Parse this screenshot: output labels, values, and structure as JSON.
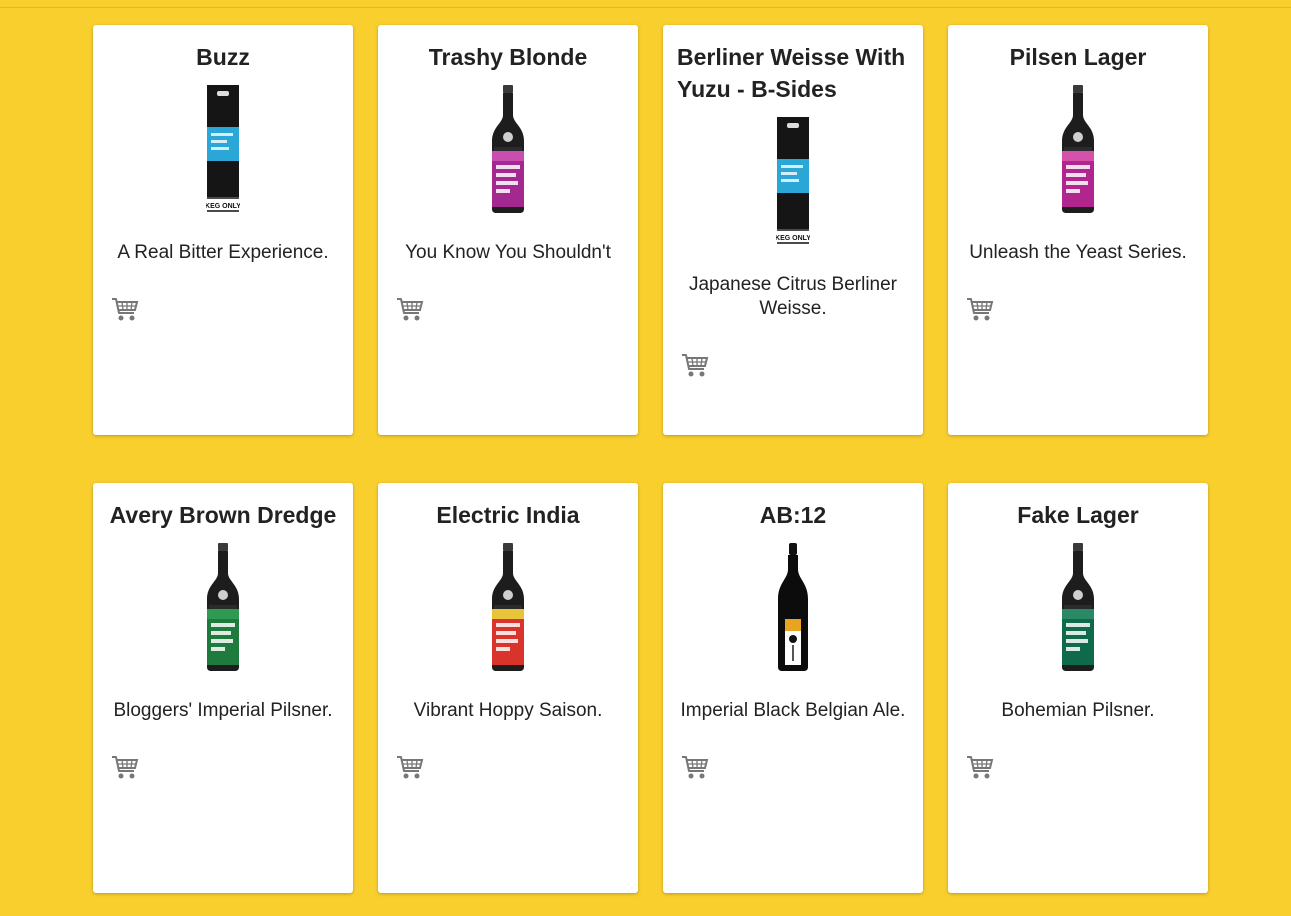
{
  "products": [
    {
      "name": "Buzz",
      "description": "A Real Bitter Experience.",
      "bottle": "keg",
      "label_color": "#2aa7d6",
      "label_color2": "#2aa7d6"
    },
    {
      "name": "Trashy Blonde",
      "description": "You Know You Shouldn't",
      "bottle": "bottle",
      "label_color": "#a3288f",
      "label_color2": "#c84fb0"
    },
    {
      "name": "Berliner Weisse With Yuzu - B-Sides",
      "description": "Japanese Citrus Berliner Weisse.",
      "bottle": "keg",
      "label_color": "#2aa7d6",
      "label_color2": "#2aa7d6"
    },
    {
      "name": "Pilsen Lager",
      "description": "Unleash the Yeast Series.",
      "bottle": "bottle",
      "label_color": "#b0268e",
      "label_color2": "#d452ac"
    },
    {
      "name": "Avery Brown Dredge",
      "description": "Bloggers' Imperial Pilsner.",
      "bottle": "bottle",
      "label_color": "#1f7a3e",
      "label_color2": "#2f9a52"
    },
    {
      "name": "Electric India",
      "description": "Vibrant Hoppy Saison.",
      "bottle": "bottle",
      "label_color": "#d8342c",
      "label_color2": "#e8c43a"
    },
    {
      "name": "AB:12",
      "description": "Imperial Black Belgian Ale.",
      "bottle": "champagne",
      "label_color": "#e8a31f",
      "label_color2": "#ffffff"
    },
    {
      "name": "Fake Lager",
      "description": "Bohemian Pilsner.",
      "bottle": "bottle",
      "label_color": "#0e6a4a",
      "label_color2": "#2a8a66"
    }
  ],
  "keg_label": "KEG ONLY",
  "cart_icon": "shopping-cart-icon"
}
